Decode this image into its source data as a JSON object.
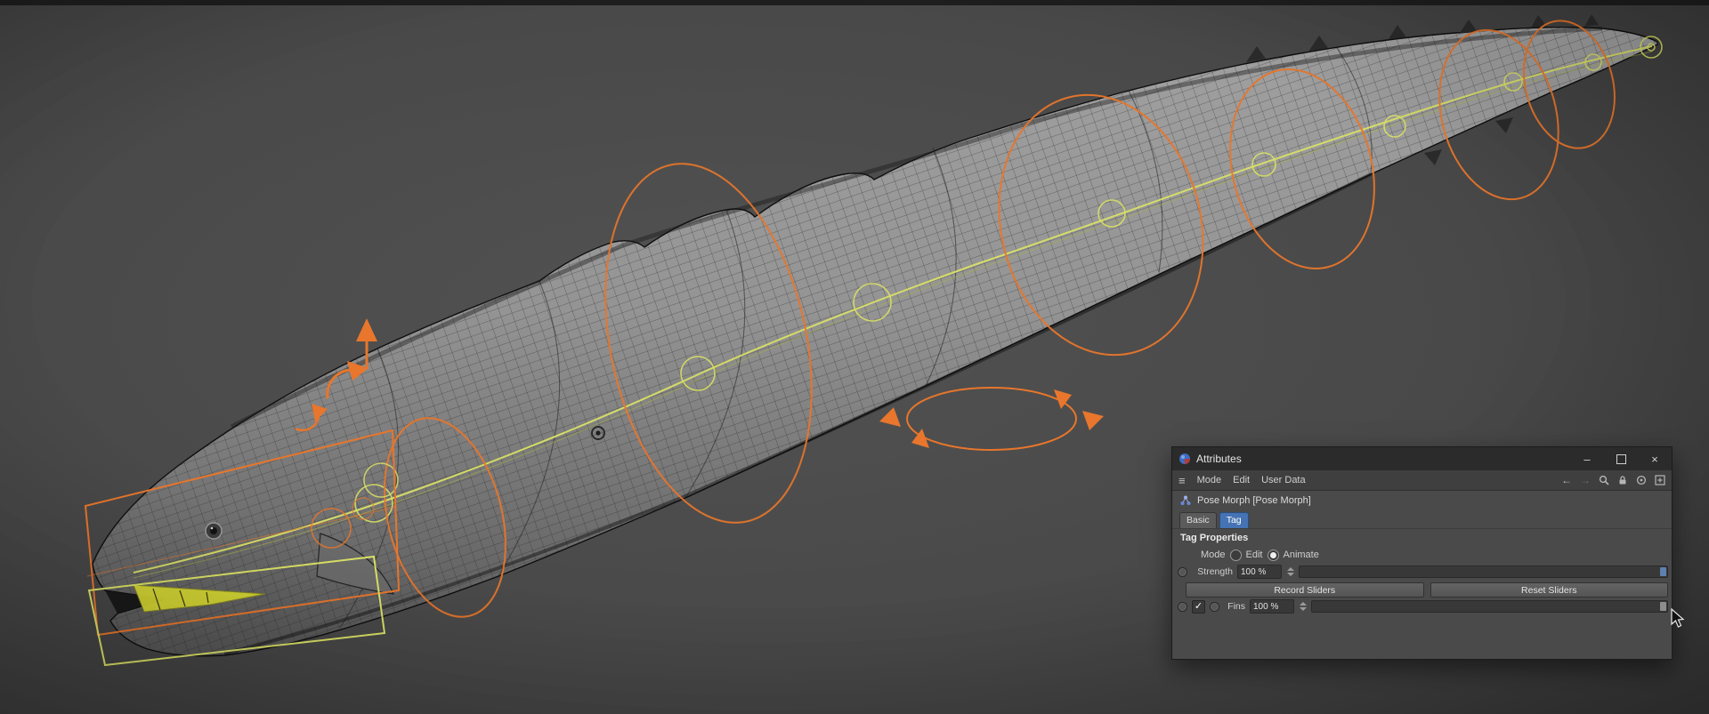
{
  "window": {
    "title": "Attributes"
  },
  "icons": {
    "hamburger": "≡",
    "back": "←",
    "forward": "→",
    "minimize": "–",
    "close": "×",
    "check": "✓"
  },
  "menu": {
    "items": [
      "Mode",
      "Edit",
      "User Data"
    ]
  },
  "object_row": {
    "label": "Pose Morph [Pose Morph]"
  },
  "tabs": {
    "basic": "Basic",
    "tag": "Tag",
    "active": "Tag"
  },
  "tag_properties": {
    "section_title": "Tag Properties",
    "mode_label": "Mode",
    "mode_options": [
      "Edit",
      "Animate"
    ],
    "mode_selected": "Animate",
    "strength_label": "Strength",
    "strength_value": "100 %",
    "record_button": "Record Sliders",
    "reset_button": "Reset Sliders",
    "fins_label": "Fins",
    "fins_value": "100 %",
    "fins_enabled": true
  },
  "colors": {
    "viewport_bg": "#4a4a4a",
    "rig_orange": "#e8762c",
    "spline_yellow": "#d9e065",
    "tab_active_blue": "#4573b4",
    "titlebar_bg": "#2b2b2b",
    "panel_bg": "#4a4a4a"
  },
  "viewport": {
    "content": "eel wireframe model with pose-morph rig controls"
  }
}
